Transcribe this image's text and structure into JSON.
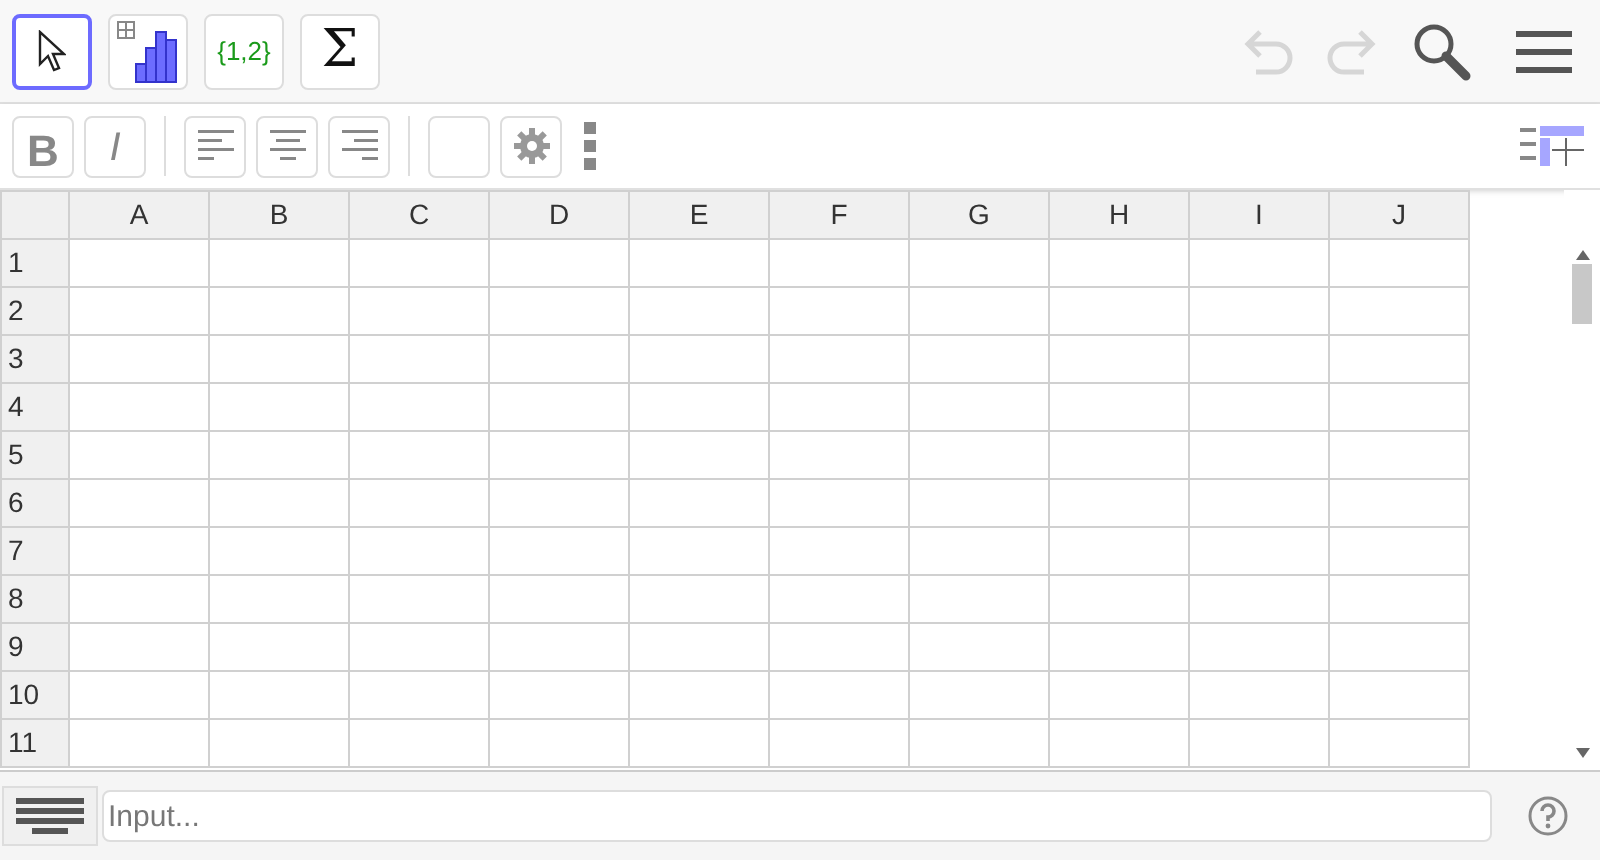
{
  "toolbar": {
    "tools": [
      {
        "kind": "pointer",
        "selected": true
      },
      {
        "kind": "analysis",
        "selected": false
      },
      {
        "kind": "list",
        "label": "{1,2}",
        "selected": false
      },
      {
        "kind": "sum",
        "label": "Σ",
        "selected": false
      }
    ],
    "undo": {
      "disabled": true
    },
    "redo": {
      "disabled": true
    }
  },
  "style_bar": {
    "bold": {
      "label": "B",
      "selected": false
    },
    "italic": {
      "label": "I",
      "selected": false
    },
    "align": [
      {
        "kind": "left",
        "selected": false
      },
      {
        "kind": "center",
        "selected": false
      },
      {
        "kind": "right",
        "selected": false
      }
    ]
  },
  "spreadsheet": {
    "columns": [
      "A",
      "B",
      "C",
      "D",
      "E",
      "F",
      "G",
      "H",
      "I",
      "J"
    ],
    "rows": [
      "1",
      "2",
      "3",
      "4",
      "5",
      "6",
      "7",
      "8",
      "9",
      "10",
      "11"
    ]
  },
  "input_bar": {
    "placeholder": "Input..."
  }
}
